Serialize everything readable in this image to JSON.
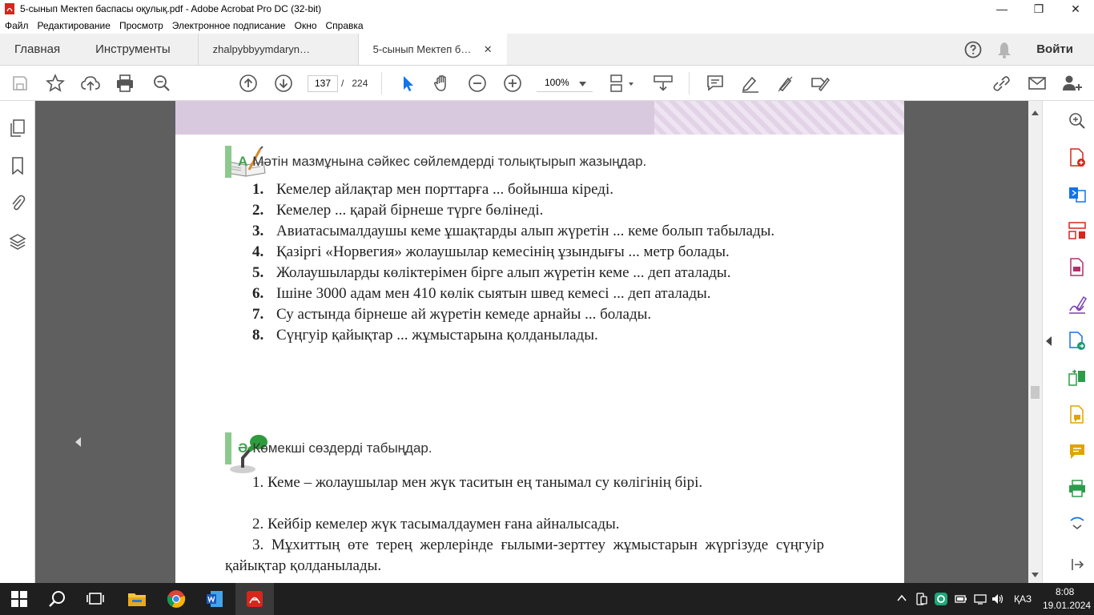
{
  "window": {
    "title": "5-сынып Мектеп баспасы оқулық.pdf - Adobe Acrobat Pro DC (32-bit)",
    "minimize": "—",
    "maximize": "❐",
    "close": "✕"
  },
  "menu": [
    "Файл",
    "Редактирование",
    "Просмотр",
    "Электронное подписание",
    "Окно",
    "Справка"
  ],
  "tabs": {
    "home": "Главная",
    "tools": "Инструменты",
    "doc1": "zhalpybbyymdaryn…",
    "doc2": "5-сынып Мектеп б…",
    "close": "✕",
    "login": "Войти"
  },
  "toolbar": {
    "page_current": "137",
    "page_separator": "/",
    "page_total": "224",
    "zoom": "100%"
  },
  "document": {
    "sectionA": {
      "letter": "А",
      "title": "Мәтін мазмұнына сәйкес сөйлемдерді толықтырып жазыңдар.",
      "items": [
        {
          "num": "1.",
          "text": "Кемелер айлақтар мен порттарға ... бойынша кіреді."
        },
        {
          "num": "2.",
          "text": "Кемелер ... қарай бірнеше түрге бөлінеді."
        },
        {
          "num": "3.",
          "text": "Авиатасымалдаушы кеме ұшақтарды алып жүретін ... кеме болып табылады."
        },
        {
          "num": "4.",
          "text": "Қазіргі «Норвегия» жолаушылар кемесінің ұзындығы ... метр болады."
        },
        {
          "num": "5.",
          "text": "Жолаушыларды көліктерімен бірге алып жүретін кеме ... деп аталады."
        },
        {
          "num": "6.",
          "text": "Ішіне 3000 адам мен 410 көлік сыятын швед кемесі ... деп аталады."
        },
        {
          "num": "7.",
          "text": "Су астында бірнеше ай жүретін кемеде арнайы ... болады."
        },
        {
          "num": "8.",
          "text": "Сүңгуір қайықтар ... жұмыстарына қолданылады."
        }
      ]
    },
    "sectionB": {
      "letter": "Ә",
      "title": "Көмекші сөздерді табыңдар.",
      "paragraphs": [
        "1. Кеме – жолаушылар мен жүк таситын ең танымал су көлігінің бірі.",
        "2. Кейбір кемелер жүк тасымалдаумен ғана айналысады.",
        "3. Мұхиттың өте терең жерлерінде ғылыми-зерттеу жұмыстарын жүргізуде сүңгуір қайықтар қолданылады."
      ]
    }
  },
  "tray": {
    "language": "ҚАЗ",
    "time": "8:08",
    "date": "19.01.2024"
  },
  "colors": {
    "acrobat_red": "#d7261c",
    "green_accent": "#3fa34d",
    "page_band": "#d9c9de",
    "viewer_bg": "#5f5f5f",
    "taskbar_bg": "#1f1f1f",
    "tool_blue": "#1473e6"
  }
}
